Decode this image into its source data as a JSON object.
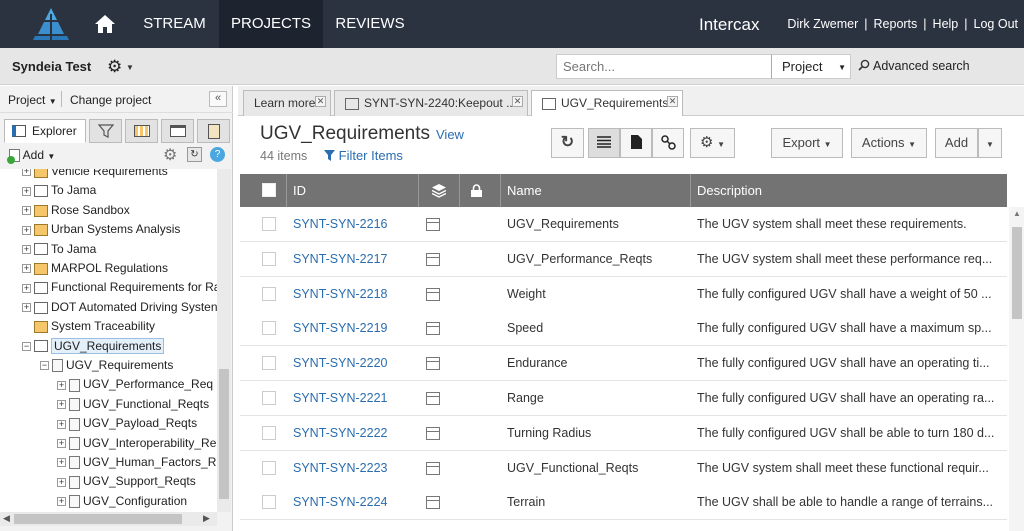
{
  "nav": {
    "stream": "STREAM",
    "projects": "PROJECTS",
    "reviews": "REVIEWS",
    "brand": "Intercax",
    "user": "Dirk Zwemer",
    "reports": "Reports",
    "help": "Help",
    "logout": "Log Out",
    "sep": "|"
  },
  "subbar": {
    "project_name": "Syndeia Test",
    "search_placeholder": "Search...",
    "scope": "Project",
    "advanced": "Advanced search"
  },
  "left": {
    "project_menu": "Project",
    "change_project": "Change project",
    "collapse": "«",
    "explorer_tab": "Explorer",
    "add": "Add",
    "tree": [
      {
        "label": "Vehicle Requirements",
        "icon": "yellow",
        "depth": 0,
        "pm": "+"
      },
      {
        "label": "To Jama",
        "icon": "plain",
        "depth": 0,
        "pm": "+"
      },
      {
        "label": "Rose Sandbox",
        "icon": "yellow",
        "depth": 0,
        "pm": "+"
      },
      {
        "label": "Urban Systems Analysis",
        "icon": "yellow",
        "depth": 0,
        "pm": "+"
      },
      {
        "label": "To Jama",
        "icon": "plain",
        "depth": 0,
        "pm": "+"
      },
      {
        "label": "MARPOL Regulations",
        "icon": "yellow",
        "depth": 0,
        "pm": "+"
      },
      {
        "label": "Functional Requirements for Ra",
        "icon": "folder",
        "depth": 0,
        "pm": "+"
      },
      {
        "label": "DOT Automated Driving Systen",
        "icon": "plain",
        "depth": 0,
        "pm": "+"
      },
      {
        "label": "System Traceability",
        "icon": "yellow",
        "depth": 0,
        "pm": ""
      },
      {
        "label": "UGV_Requirements",
        "icon": "plain",
        "depth": 0,
        "pm": "−",
        "selected": true
      },
      {
        "label": "UGV_Requirements",
        "icon": "doc",
        "depth": 1,
        "pm": "−"
      },
      {
        "label": "UGV_Performance_Req",
        "icon": "doc",
        "depth": 2,
        "pm": "+"
      },
      {
        "label": "UGV_Functional_Reqts",
        "icon": "doc",
        "depth": 2,
        "pm": "+"
      },
      {
        "label": "UGV_Payload_Reqts",
        "icon": "doc",
        "depth": 2,
        "pm": "+"
      },
      {
        "label": "UGV_Interoperability_Re",
        "icon": "doc",
        "depth": 2,
        "pm": "+"
      },
      {
        "label": "UGV_Human_Factors_R",
        "icon": "doc",
        "depth": 2,
        "pm": "+"
      },
      {
        "label": "UGV_Support_Reqts",
        "icon": "doc",
        "depth": 2,
        "pm": "+"
      },
      {
        "label": "UGV_Configuration",
        "icon": "doc",
        "depth": 2,
        "pm": "+"
      }
    ]
  },
  "tabs": [
    {
      "label": "Learn more",
      "icon": false,
      "active": false
    },
    {
      "label": "SYNT-SYN-2240:Keepout ...",
      "icon": true,
      "active": false
    },
    {
      "label": "UGV_Requirements",
      "icon": true,
      "active": true
    }
  ],
  "page": {
    "title": "UGV_Requirements",
    "view": "View",
    "count": "44 items",
    "filter": "Filter Items"
  },
  "toolbar": {
    "export": "Export",
    "actions": "Actions",
    "add": "Add"
  },
  "table": {
    "columns": {
      "id": "ID",
      "name": "Name",
      "description": "Description"
    },
    "rows": [
      {
        "id": "SYNT-SYN-2216",
        "name": "UGV_Requirements",
        "description": "The UGV system shall meet these requirements."
      },
      {
        "id": "SYNT-SYN-2217",
        "name": "UGV_Performance_Reqts",
        "description": "The UGV system shall meet these performance req..."
      },
      {
        "id": "SYNT-SYN-2218",
        "name": "Weight",
        "description": "The fully configured UGV shall have a weight of 50 ..."
      },
      {
        "id": "SYNT-SYN-2219",
        "name": "Speed",
        "description": "The fully configured UGV shall have a maximum sp..."
      },
      {
        "id": "SYNT-SYN-2220",
        "name": "Endurance",
        "description": "The fully configured UGV shall have an operating ti..."
      },
      {
        "id": "SYNT-SYN-2221",
        "name": "Range",
        "description": "The fully configured UGV shall have an operating ra..."
      },
      {
        "id": "SYNT-SYN-2222",
        "name": "Turning Radius",
        "description": "The fully configured UGV shall be able to turn 180 d..."
      },
      {
        "id": "SYNT-SYN-2223",
        "name": "UGV_Functional_Reqts",
        "description": "The UGV system shall meet these functional requir..."
      },
      {
        "id": "SYNT-SYN-2224",
        "name": "Terrain",
        "description": "The UGV shall be able to handle a range of terrains..."
      }
    ]
  },
  "colors": {
    "nav_bg": "#2b3240",
    "link": "#2a6db0",
    "grid_header": "#737373"
  }
}
